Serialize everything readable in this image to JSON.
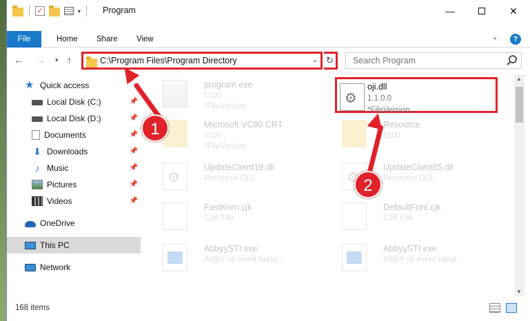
{
  "window": {
    "title": "Program"
  },
  "ribbon": {
    "tabs": [
      "File",
      "Home",
      "Share",
      "View"
    ]
  },
  "address": {
    "path": "C:\\Program Files\\Program Directory"
  },
  "search": {
    "placeholder": "Search Program"
  },
  "sidebar": {
    "items": [
      {
        "label": "Quick access",
        "icon": "star-icon"
      },
      {
        "label": "Local Disk (C:)",
        "icon": "disk-icon",
        "pinned": true
      },
      {
        "label": "Local Disk (D:)",
        "icon": "disk-icon",
        "pinned": true
      },
      {
        "label": "Documents",
        "icon": "documents-icon",
        "pinned": true
      },
      {
        "label": "Downloads",
        "icon": "download-icon",
        "pinned": true
      },
      {
        "label": "Music",
        "icon": "music-icon",
        "pinned": true
      },
      {
        "label": "Pictures",
        "icon": "pictures-icon",
        "pinned": true
      },
      {
        "label": "Videos",
        "icon": "videos-icon",
        "pinned": true
      },
      {
        "label": "OneDrive",
        "icon": "onedrive-icon"
      },
      {
        "label": "This PC",
        "icon": "pc-icon",
        "selected": true
      },
      {
        "label": "Network",
        "icon": "network-icon"
      }
    ]
  },
  "files": [
    {
      "name": "program.exe",
      "line2": "1100",
      "line3": "*FileVersion",
      "icon": "exe-icon",
      "faded": true
    },
    {
      "name": "oji.dll",
      "line2": "1.1.0.0",
      "line3": "*FileVersion",
      "icon": "dll-gear-icon",
      "highlighted": true
    },
    {
      "name": "Microsoft VC90 CRT",
      "line2": "1100",
      "line3": "*FileVersion",
      "icon": "folder-icon",
      "faded": true
    },
    {
      "name": "Resource",
      "line2": "1100",
      "line3": "",
      "icon": "folder-icon",
      "faded": true
    },
    {
      "name": "UpdateClient19.dll",
      "line2": "Resource DLL",
      "line3": "",
      "icon": "dll-gear-icon",
      "faded": true
    },
    {
      "name": "UpdateClient65.dll",
      "line2": "Resource DLL",
      "line3": "",
      "icon": "dll-gear-icon",
      "faded": true
    },
    {
      "name": "FastKorn.cjk",
      "line2": "CJK File",
      "line3": "",
      "icon": "file-icon",
      "faded": true
    },
    {
      "name": "DefaultFont.cjk",
      "line2": "CJK File",
      "line3": "",
      "icon": "file-icon",
      "faded": true
    },
    {
      "name": "AbbyySTI.exe",
      "line2": "ABBY sti event hand...",
      "line3": "",
      "icon": "app-icon",
      "faded": true
    },
    {
      "name": "AbbyySTI.exe",
      "line2": "ABBY sti event hand...",
      "line3": "",
      "icon": "app-icon",
      "faded": true
    }
  ],
  "status": {
    "item_count": "168 items"
  },
  "callouts": [
    "1",
    "2"
  ],
  "colors": {
    "accent": "#1979ca",
    "highlight": "#e0222a"
  }
}
